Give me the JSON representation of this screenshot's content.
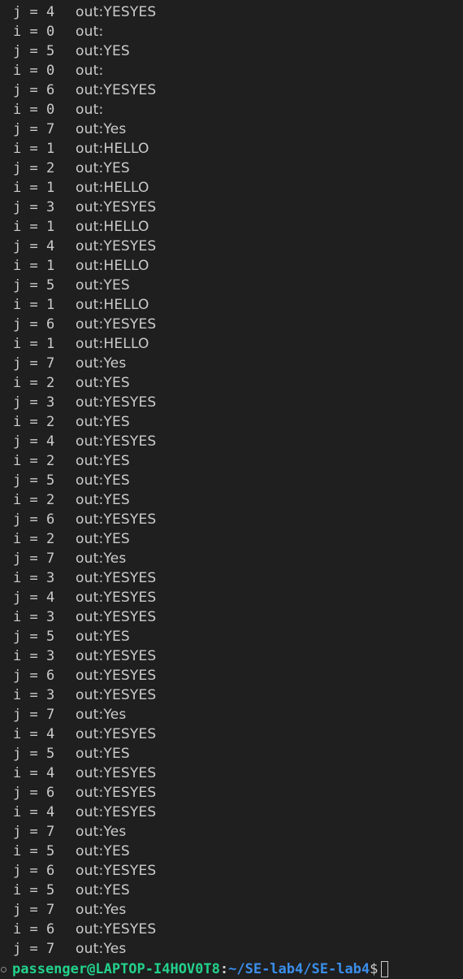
{
  "terminal": {
    "lines": [
      {
        "lhs": "j = 4",
        "rhs": "out:YESYES"
      },
      {
        "lhs": "i = 0",
        "rhs": "out:"
      },
      {
        "lhs": "j = 5",
        "rhs": "out:YES"
      },
      {
        "lhs": "i = 0",
        "rhs": "out:"
      },
      {
        "lhs": "j = 6",
        "rhs": "out:YESYES"
      },
      {
        "lhs": "i = 0",
        "rhs": "out:"
      },
      {
        "lhs": "j = 7",
        "rhs": "out:Yes"
      },
      {
        "lhs": "i = 1",
        "rhs": "out:HELLO"
      },
      {
        "lhs": "j = 2",
        "rhs": "out:YES"
      },
      {
        "lhs": "i = 1",
        "rhs": "out:HELLO"
      },
      {
        "lhs": "j = 3",
        "rhs": "out:YESYES"
      },
      {
        "lhs": "i = 1",
        "rhs": "out:HELLO"
      },
      {
        "lhs": "j = 4",
        "rhs": "out:YESYES"
      },
      {
        "lhs": "i = 1",
        "rhs": "out:HELLO"
      },
      {
        "lhs": "j = 5",
        "rhs": "out:YES"
      },
      {
        "lhs": "i = 1",
        "rhs": "out:HELLO"
      },
      {
        "lhs": "j = 6",
        "rhs": "out:YESYES"
      },
      {
        "lhs": "i = 1",
        "rhs": "out:HELLO"
      },
      {
        "lhs": "j = 7",
        "rhs": "out:Yes"
      },
      {
        "lhs": "i = 2",
        "rhs": "out:YES"
      },
      {
        "lhs": "j = 3",
        "rhs": "out:YESYES"
      },
      {
        "lhs": "i = 2",
        "rhs": "out:YES"
      },
      {
        "lhs": "j = 4",
        "rhs": "out:YESYES"
      },
      {
        "lhs": "i = 2",
        "rhs": "out:YES"
      },
      {
        "lhs": "j = 5",
        "rhs": "out:YES"
      },
      {
        "lhs": "i = 2",
        "rhs": "out:YES"
      },
      {
        "lhs": "j = 6",
        "rhs": "out:YESYES"
      },
      {
        "lhs": "i = 2",
        "rhs": "out:YES"
      },
      {
        "lhs": "j = 7",
        "rhs": "out:Yes"
      },
      {
        "lhs": "i = 3",
        "rhs": "out:YESYES"
      },
      {
        "lhs": "j = 4",
        "rhs": "out:YESYES"
      },
      {
        "lhs": "i = 3",
        "rhs": "out:YESYES"
      },
      {
        "lhs": "j = 5",
        "rhs": "out:YES"
      },
      {
        "lhs": "i = 3",
        "rhs": "out:YESYES"
      },
      {
        "lhs": "j = 6",
        "rhs": "out:YESYES"
      },
      {
        "lhs": "i = 3",
        "rhs": "out:YESYES"
      },
      {
        "lhs": "j = 7",
        "rhs": "out:Yes"
      },
      {
        "lhs": "i = 4",
        "rhs": "out:YESYES"
      },
      {
        "lhs": "j = 5",
        "rhs": "out:YES"
      },
      {
        "lhs": "i = 4",
        "rhs": "out:YESYES"
      },
      {
        "lhs": "j = 6",
        "rhs": "out:YESYES"
      },
      {
        "lhs": "i = 4",
        "rhs": "out:YESYES"
      },
      {
        "lhs": "j = 7",
        "rhs": "out:Yes"
      },
      {
        "lhs": "i = 5",
        "rhs": "out:YES"
      },
      {
        "lhs": "j = 6",
        "rhs": "out:YESYES"
      },
      {
        "lhs": "i = 5",
        "rhs": "out:YES"
      },
      {
        "lhs": "j = 7",
        "rhs": "out:Yes"
      },
      {
        "lhs": "i = 6",
        "rhs": "out:YESYES"
      },
      {
        "lhs": "j = 7",
        "rhs": "out:Yes"
      }
    ],
    "prompt": {
      "user_host": "passenger@LAPTOP-I4HOV0T8",
      "colon": ":",
      "path": "~/SE-lab4/SE-lab4",
      "symbol": "$"
    },
    "colors": {
      "background": "#1f1f1f",
      "text": "#cccccc",
      "user_host": "#23d18b",
      "path": "#3b8eea"
    }
  }
}
